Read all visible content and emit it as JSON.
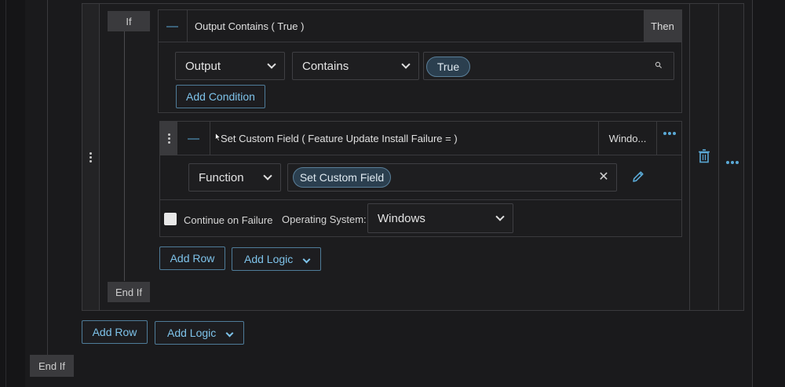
{
  "if_block": {
    "if_label": "If",
    "end_if_label": "End If",
    "condition": {
      "title": "Output Contains ( True )",
      "then_label": "Then",
      "field_select": "Output",
      "operator_select": "Contains",
      "value_chip": "True",
      "add_condition_label": "Add Condition"
    },
    "action": {
      "title": "Set Custom Field ( Feature Update Install Failure = )",
      "os_short": "Windo...",
      "type_select": "Function",
      "function_chip": "Set Custom Field",
      "continue_on_failure_label": "Continue on Failure",
      "continue_on_failure_checked": false,
      "os_label": "Operating System:",
      "os_select": "Windows"
    },
    "add_row_label": "Add Row",
    "add_logic_label": "Add Logic"
  },
  "outer": {
    "add_row_label": "Add Row",
    "add_logic_label": "Add Logic",
    "end_if_label": "End If"
  },
  "colors": {
    "accent": "#5aa9d6",
    "background": "#1a1a1c",
    "border": "#3a3a3d"
  }
}
